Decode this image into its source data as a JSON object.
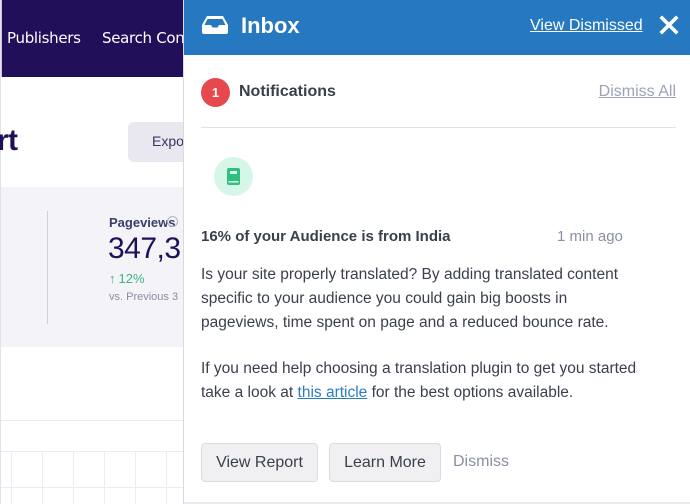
{
  "background": {
    "nav": {
      "items": [
        {
          "label": "Publishers"
        },
        {
          "label": "Search Cons"
        }
      ]
    },
    "report_title": "ort",
    "export_label": "Expo",
    "stats": {
      "pageviews": {
        "label": "Pageviews",
        "value": "347,3",
        "change": "12%",
        "change_direction": "up",
        "compare": "vs. Previous 3"
      }
    }
  },
  "inbox": {
    "title": "Inbox",
    "view_dismissed_label": "View Dismissed",
    "close_label": "Close",
    "notifications": {
      "count": "1",
      "heading": "Notifications",
      "dismiss_all_label": "Dismiss All"
    },
    "items": [
      {
        "icon": "book-icon",
        "title": "16% of your Audience is from India",
        "time": "1 min ago",
        "paragraph1": "Is your site properly translated? By adding translated content specific to your audience you could gain big boosts in pageviews, time spent on page and a reduced bounce rate.",
        "paragraph2_before": "If you need help choosing a translation plugin to get you started take a look at ",
        "paragraph2_link": "this article",
        "paragraph2_after": " for the best options available.",
        "actions": {
          "view_report": "View Report",
          "learn_more": "Learn More",
          "dismiss": "Dismiss"
        }
      }
    ]
  },
  "colors": {
    "header_blue": "#2679c1",
    "nav_purple": "#210f59",
    "badge_red": "#e5484d",
    "success_green": "#3cb48a",
    "icon_green": "#2fbf7f",
    "link_blue": "#2a7dbf"
  }
}
